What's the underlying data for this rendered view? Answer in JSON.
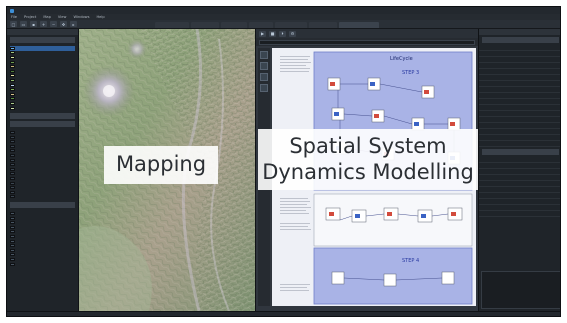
{
  "window": {
    "title": ""
  },
  "menu": {
    "items": [
      "File",
      "Project",
      "Map",
      "View",
      "Windows",
      "Help"
    ]
  },
  "toolbar": {
    "icons": [
      "new-icon",
      "open-icon",
      "save-icon",
      "zoom-in-icon",
      "zoom-out-icon",
      "pan-icon",
      "select-icon"
    ]
  },
  "tabs": {
    "items": [
      "",
      "",
      "",
      "",
      "",
      "",
      ""
    ]
  },
  "left_panel": {
    "header": "",
    "map_layers_title": "",
    "state_objects_title": "",
    "model_components_title": "",
    "user_models_title": ""
  },
  "overlays": {
    "mapping": "Mapping",
    "ssdm_line1": "Spatial System",
    "ssdm_line2": "Dynamics Modelling"
  },
  "diagram": {
    "top_label": "LifeCycle",
    "step_top": "STEP 3",
    "step_bottom": "STEP 4"
  },
  "colors": {
    "accent": "#3d8fd6",
    "panel_bg": "#1f2429",
    "diagram_bg": "#eef0f6",
    "diagram_bg_blue": "#a9b3e6"
  }
}
